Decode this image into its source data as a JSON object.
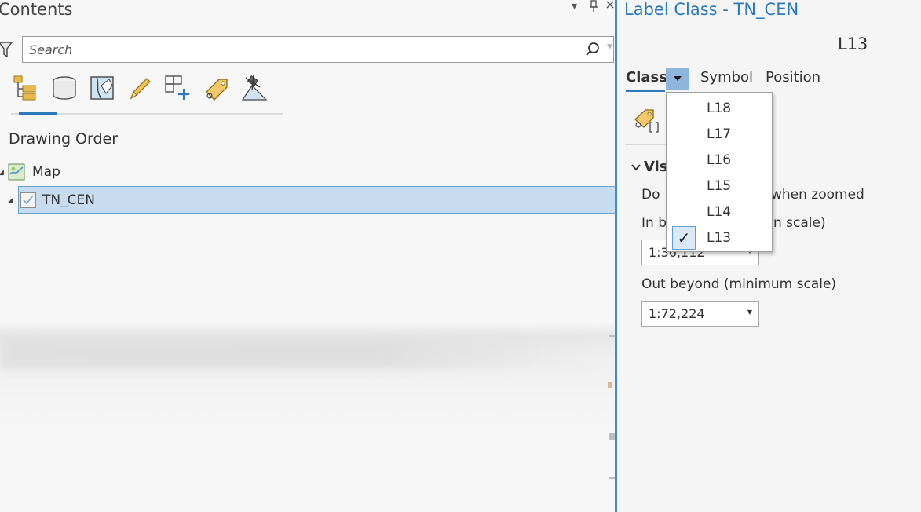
{
  "contents": {
    "title": "Contents",
    "pin_glyph": "▾",
    "dock_glyph": "⊥",
    "search": {
      "placeholder": "Search",
      "value": ""
    },
    "toolbar": [
      {
        "icon": "list-by-drawing-order-icon",
        "active": true
      },
      {
        "icon": "list-by-data-source-icon"
      },
      {
        "icon": "list-by-selection-icon"
      },
      {
        "icon": "list-by-editing-icon"
      },
      {
        "icon": "list-by-snapping-icon"
      },
      {
        "icon": "list-by-labeling-icon"
      },
      {
        "icon": "list-by-perspective-imagery-icon"
      }
    ],
    "section_heading": "Drawing Order",
    "map_label": "Map",
    "layer_label": "TN_CEN"
  },
  "label_class": {
    "title": "Label Class - TN_CEN",
    "current_class": "L13",
    "tabs": {
      "class": "Class",
      "symbol": "Symbol",
      "position": "Position"
    },
    "visibility_heading": "Vis",
    "line_do": "Do",
    "line_zoomed": "when zoomed",
    "line_in_b": "In b",
    "line_in_scale": "n scale)",
    "in_beyond_value": "1:36,112",
    "out_beyond_label": "Out beyond (minimum scale)",
    "out_beyond_value": "1:72,224"
  },
  "class_menu": {
    "items": [
      "L18",
      "L17",
      "L16",
      "L15",
      "L14",
      "L13"
    ],
    "checked": "L13",
    "check_glyph": "✓"
  },
  "colors": {
    "accent": "#2b79c2",
    "selection_fill": "#c7dcef",
    "divider": "#3c8ad0"
  }
}
